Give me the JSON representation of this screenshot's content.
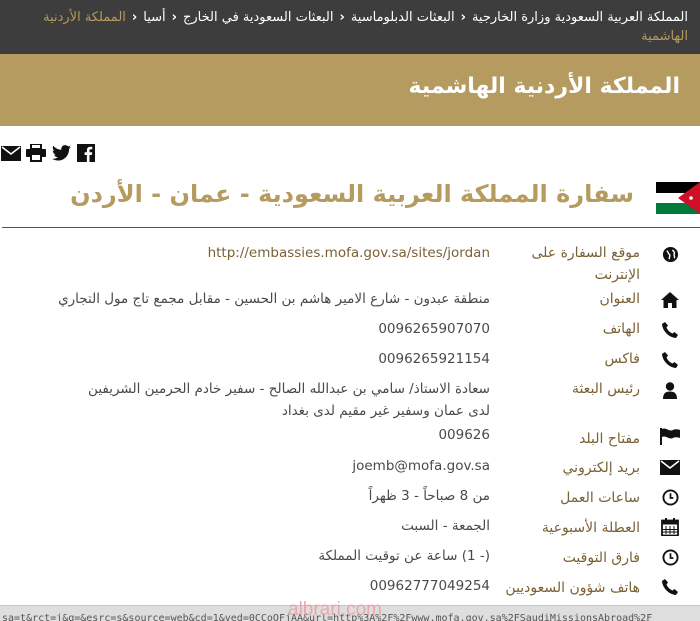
{
  "breadcrumb": {
    "items": [
      "المملكة العربية السعودية وزارة الخارجية",
      "البعثات الدبلوماسية",
      "البعثات السعودية في الخارج",
      "أسيا",
      "المملكة الأردنية الهاشمية"
    ]
  },
  "page_title": "المملكة الأردنية الهاشمية",
  "share_icons": [
    "facebook-icon",
    "twitter-icon",
    "print-icon",
    "email-icon"
  ],
  "embassy": {
    "heading": "سفارة المملكة العربية السعودية - عمان - الأردن",
    "flag_colors": {
      "black": "#000000",
      "white": "#ffffff",
      "green": "#007a3d",
      "red": "#ce1126"
    }
  },
  "details": {
    "website": {
      "label": "موقع السفارة على الإنترنت",
      "value": "http://embassies.mofa.gov.sa/sites/jordan"
    },
    "address": {
      "label": "العنوان",
      "value": "منطقة عبدون - شارع الامير هاشم بن الحسين - مقابل مجمع تاج مول التجاري"
    },
    "phone": {
      "label": "الهاتف",
      "value": "0096265907070"
    },
    "fax": {
      "label": "فاكس",
      "value": "0096265921154"
    },
    "head": {
      "label": "رئيس البعثة",
      "value_line1": "سعادة الاستاذ/ سامي بن عبدالله الصالح  - سفير خادم الحرمين الشريفين",
      "value_line2": "لدى عمان وسفير غير مقيم لدى بغداد"
    },
    "country_code": {
      "label": "مفتاح البلد",
      "value": "009626"
    },
    "email": {
      "label": "بريد إلكتروني",
      "value": "joemb@mofa.gov.sa"
    },
    "hours": {
      "label": "ساعات العمل",
      "value": "من 8 صباحاً - 3 ظهراً"
    },
    "weekend": {
      "label": "العطلة الأسبوعية",
      "value": "الجمعة - السبت"
    },
    "timezone": {
      "label": "فارق التوقيت",
      "value": "(- 1) ساعة عن توقيت المملكة"
    },
    "saudi_affairs": {
      "label": "هاتف شؤون السعوديين",
      "value": "00962777049254"
    }
  },
  "status_url": "sa=t&rct=j&q=&esrc=s&source=web&cd=1&ved=0CCoQFjAA&url=http%3A%2F%2Fwww.mofa.gov.sa%2FSaudiMissionsAbroad%2F",
  "watermark": "albrari.com",
  "colors": {
    "accent": "#b59b5f",
    "crumbbar": "#3d3d3d",
    "label": "#7a6134"
  }
}
